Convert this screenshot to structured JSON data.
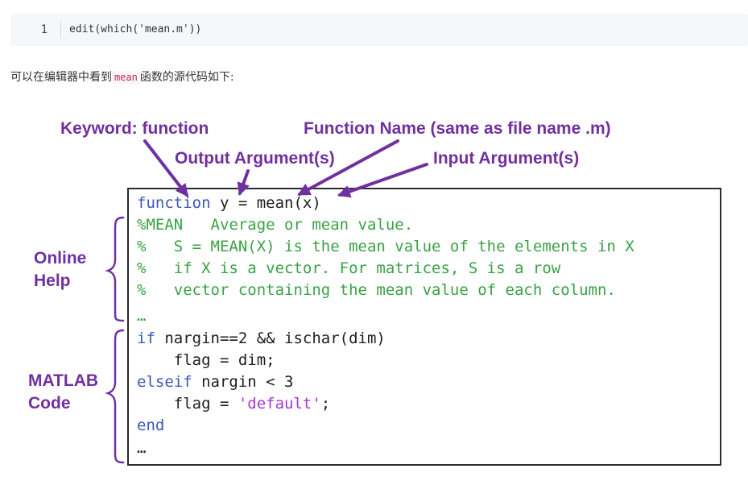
{
  "snippet": {
    "line_number": "1",
    "code": "edit(which('mean.m'))"
  },
  "paragraph": {
    "before": "可以在编辑器中看到",
    "code": "mean",
    "after": "函数的源代码如下:"
  },
  "figure": {
    "labels": {
      "keyword": "Keyword: function",
      "function_name": "Function Name (same as file name .m)",
      "output_argument": "Output Argument(s)",
      "input_argument": "Input Argument(s)",
      "online_help_line1": "Online",
      "online_help_line2": "Help",
      "matlab_code_line1": "MATLAB",
      "matlab_code_line2": "Code"
    },
    "code_lines": [
      [
        {
          "t": "function",
          "c": "kw"
        },
        {
          "t": " y = mean(x)",
          "c": "pl"
        }
      ],
      [
        {
          "t": "%MEAN   Average or mean value.",
          "c": "cm"
        }
      ],
      [
        {
          "t": "%   S = MEAN(X) is the mean value of the elements in X",
          "c": "cm"
        }
      ],
      [
        {
          "t": "%   if X is a vector. For matrices, S is a row",
          "c": "cm"
        }
      ],
      [
        {
          "t": "%   vector containing the mean value of each column.",
          "c": "cm"
        }
      ],
      [
        {
          "t": "…",
          "c": "cm"
        }
      ],
      [
        {
          "t": "if",
          "c": "kw"
        },
        {
          "t": " nargin==2 && ischar(dim)",
          "c": "pl"
        }
      ],
      [
        {
          "t": "    flag = dim;",
          "c": "pl"
        }
      ],
      [
        {
          "t": "elseif",
          "c": "kw"
        },
        {
          "t": " nargin < 3",
          "c": "pl"
        }
      ],
      [
        {
          "t": "    flag = ",
          "c": "pl"
        },
        {
          "t": "'default'",
          "c": "str"
        },
        {
          "t": ";",
          "c": "pl"
        }
      ],
      [
        {
          "t": "end",
          "c": "kw"
        }
      ],
      [
        {
          "t": "…",
          "c": "pl"
        }
      ]
    ],
    "colors": {
      "annotation": "#7030a0",
      "keyword": "#3a58b8",
      "comment": "#3aa245",
      "string": "#a635d9"
    }
  }
}
